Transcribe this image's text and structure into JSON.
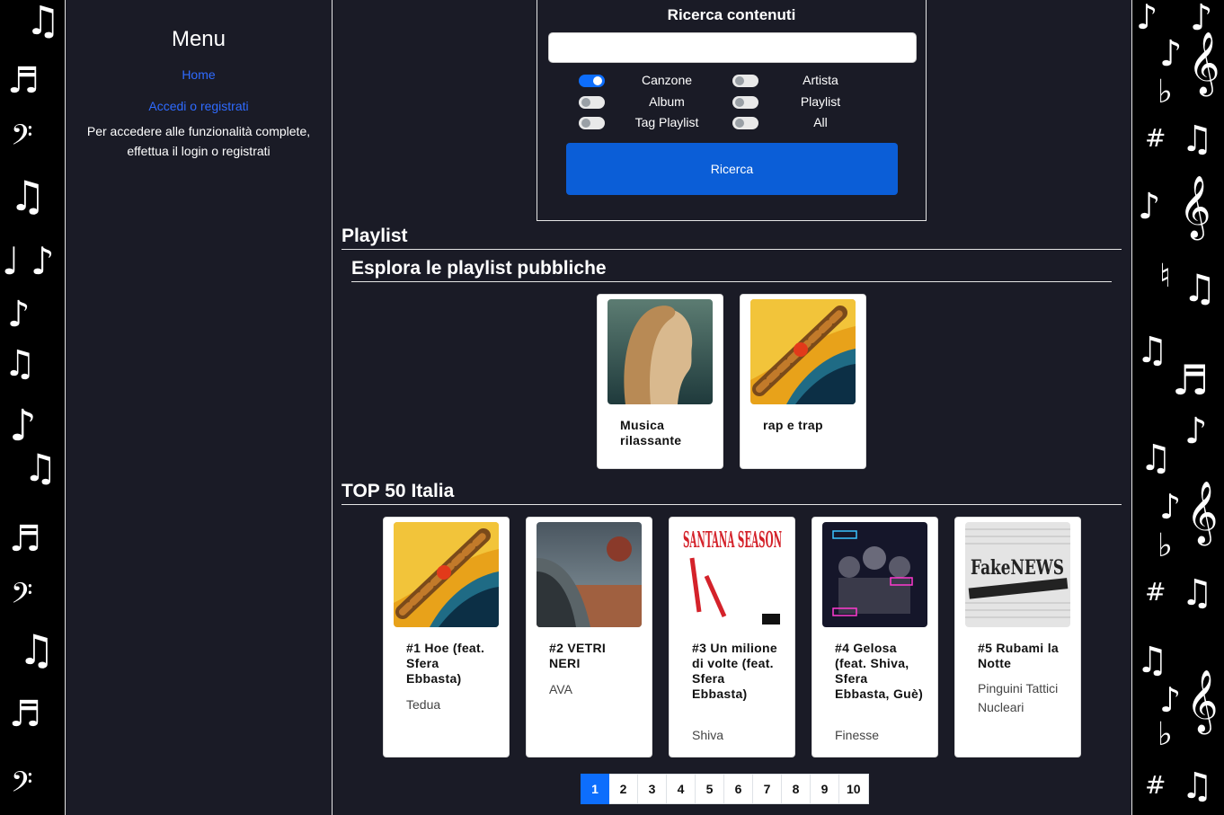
{
  "sidebar": {
    "title": "Menu",
    "home_link": "Home",
    "login_link": "Accedi o registrati",
    "notice": "Per accedere alle funzionalità complete, effettua il login o registrati"
  },
  "search": {
    "title": "Ricerca contenuti",
    "input_value": "",
    "filters": [
      {
        "label": "Canzone",
        "checked": true
      },
      {
        "label": "Artista",
        "checked": false
      },
      {
        "label": "Album",
        "checked": false
      },
      {
        "label": "Playlist",
        "checked": false
      },
      {
        "label": "Tag Playlist",
        "checked": false
      },
      {
        "label": "All",
        "checked": false
      }
    ],
    "button_label": "Ricerca"
  },
  "playlist_section": {
    "title": "Playlist",
    "subtitle": "Esplora le playlist pubbliche",
    "cards": [
      {
        "title": "Musica rilassante",
        "cover": "portrait-album-cover"
      },
      {
        "title": "rap e trap",
        "cover": "chain-planet-cover"
      }
    ]
  },
  "top50": {
    "title": "TOP 50 Italia",
    "cards": [
      {
        "title": "#1 Hoe (feat. Sfera Ebbasta)",
        "artist": "Tedua",
        "cover": "chain-planet-cover"
      },
      {
        "title": "#2 VETRI NERI",
        "artist": "AVA",
        "cover": "car-desert-cover"
      },
      {
        "title": "#3 Un milione di volte (feat. Sfera Ebbasta)",
        "artist": "Shiva",
        "cover": "santana-season-cover",
        "cover_text": "SANTANA SEASON"
      },
      {
        "title": "#4 Gelosa (feat. Shiva, Sfera Ebbasta, Guè)",
        "artist": "Finesse",
        "cover": "group-neon-cover"
      },
      {
        "title": "#5 Rubami la Notte",
        "artist": "Pinguini Tattici Nucleari",
        "cover": "fake-news-cover",
        "cover_text": "FakeNEWS"
      }
    ]
  },
  "pagination": {
    "pages": [
      "1",
      "2",
      "3",
      "4",
      "5",
      "6",
      "7",
      "8",
      "9",
      "10"
    ],
    "active": "1"
  },
  "colors": {
    "background": "#1a1b26",
    "accent": "#0d6efd",
    "link": "#2f6bff"
  }
}
